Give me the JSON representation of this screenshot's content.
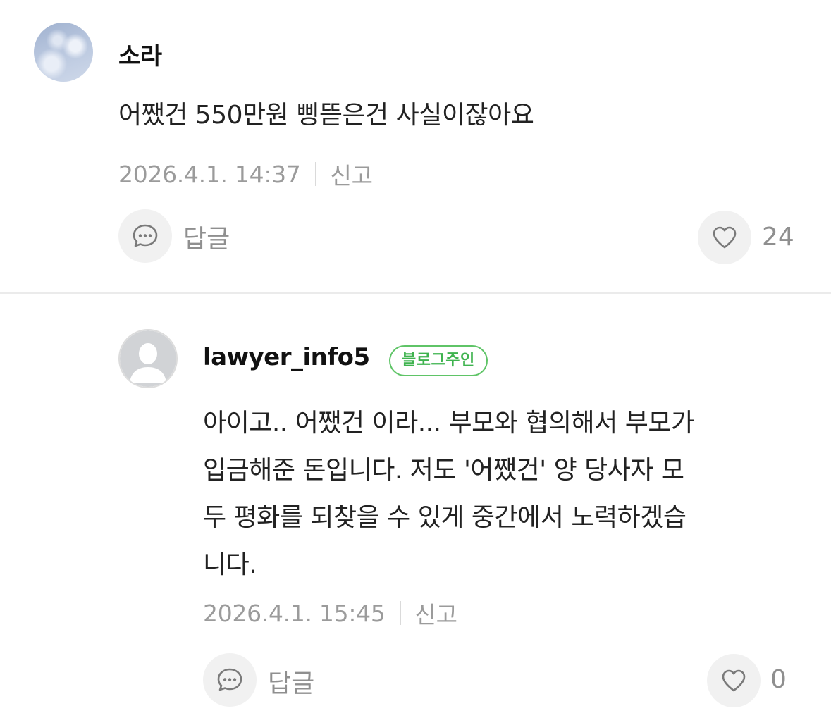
{
  "comments": [
    {
      "nickname": "소라",
      "text_lines": [
        "어쨌건 550만원 삥뜯은건 사실이잖아요"
      ],
      "timestamp": "2026.4.1. 14:37",
      "report_label": "신고",
      "reply_label": "답글",
      "like_count": "24",
      "avatar": "sky-photo"
    },
    {
      "nickname": "lawyer_info5",
      "badge": "블로그주인",
      "text_lines": [
        "아이고.. 어쨌건 이라... 부모와 협의해서 부모가",
        "입금해준 돈입니다. 저도 '어쨌건' 양 당사자 모",
        "두 평화를 되찾을 수 있게 중간에서 노력하겠습",
        "니다."
      ],
      "timestamp": "2026.4.1. 15:45",
      "report_label": "신고",
      "reply_label": "답글",
      "like_count": "0",
      "avatar": "default-profile"
    }
  ],
  "colors": {
    "badge_green": "#5fc467",
    "meta_gray": "#9b9b9b",
    "icon_bg": "#f1f1f1"
  },
  "icons": [
    "speech-bubble-icon",
    "heart-icon",
    "default-user-icon"
  ]
}
